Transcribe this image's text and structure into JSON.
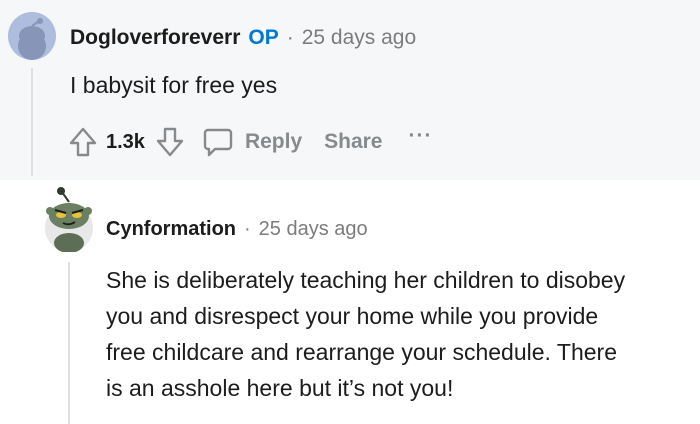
{
  "comments": [
    {
      "author": "Dogloverforeverr",
      "flair": "OP",
      "separator": "·",
      "time": "25 days ago",
      "text": "I babysit for free yes",
      "score": "1.3k",
      "reply_label": "Reply",
      "share_label": "Share",
      "more_label": "···"
    },
    {
      "author": "Cynformation",
      "separator": "·",
      "time": "25 days ago",
      "text_lines": [
        "She is deliberately teaching her children to disobey",
        "you and disrespect your home while you provide",
        "free childcare and rearrange your schedule. There",
        "is an asshole here but it’s not you!"
      ]
    }
  ],
  "colors": {
    "op_blue": "#0079d3",
    "muted": "#878a8c",
    "top_bg": "#f6f7f8"
  }
}
